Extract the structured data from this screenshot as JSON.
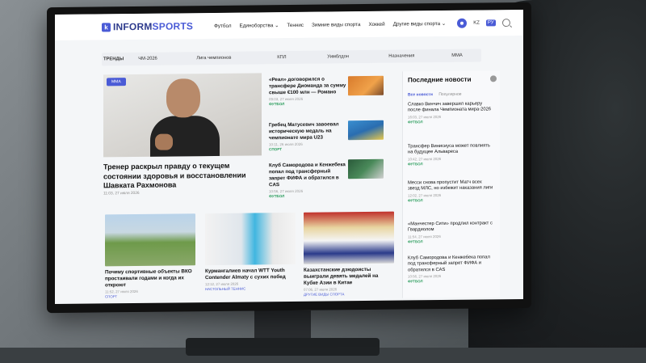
{
  "logo": {
    "letter": "k",
    "name_a": "INFORM",
    "name_b": "SPORTS"
  },
  "nav": [
    "Футбол",
    "Единоборства ⌄",
    "Теннис",
    "Зимние виды спорта",
    "Хоккей",
    "Другие виды спорта ⌄"
  ],
  "langs": {
    "kz": "KZ",
    "ru": "РУ"
  },
  "trends": {
    "label": "ТРЕНДЫ",
    "items": [
      "ЧМ-2026",
      "Лига чемпионов",
      "КПЛ",
      "Уимблдон",
      "Назначения",
      "ММА"
    ]
  },
  "feature": {
    "badge": "ММА",
    "title": "Тренер раскрыл правду о текущем состоянии здоровья и восстановлении Шавката Рахмонова",
    "time": "11:03, 27 июля 2026"
  },
  "middle": [
    {
      "title": "«Реал» договорился о трансфере Диоманда за сумму свыше €100 млн — Романо",
      "time": "09:03, 27 июля 2026",
      "cat": "ФУТБОЛ"
    },
    {
      "title": "Гребец Матусевич завоевал историческую медаль на чемпионате мира U23",
      "time": "10:11, 26 июля 2026",
      "cat": "СПОРТ"
    },
    {
      "title": "Клуб Самородова и Кенжебека попал под трансферный запрет ФИФА и обратился в CAS",
      "time": "10:56, 27 июля 2026",
      "cat": "ФУТБОЛ"
    }
  ],
  "sidebar": {
    "title": "Последние новости",
    "tab_all": "Все новости",
    "tab_popular": "Популярное",
    "items": [
      {
        "title": "Славко Винчич завершил карьеру после финала Чемпионата мира-2026",
        "time": "16:03, 27 июля 2026",
        "cat": "ФУТБОЛ"
      },
      {
        "title": "Трансфер Винисиуса может повлиять на будущее Альвареса",
        "time": "10:42, 27 июля 2026",
        "cat": "ФУТБОЛ"
      },
      {
        "title": "Месси снова пропустит Матч всех звезд МЛС, но избежит наказания лиги",
        "time": "12:02, 27 июля 2026",
        "cat": "ФУТБОЛ"
      },
      {
        "title": "«Манчестер Сити» продлил контракт с Гвардиолом",
        "time": "11:54, 27 июля 2026",
        "cat": "ФУТБОЛ"
      },
      {
        "title": "Клуб Самородова и Кенжебека попал под трансферный запрет ФИФА и обратился в CAS",
        "time": "10:56, 27 июля 2026",
        "cat": "ФУТБОЛ"
      }
    ]
  },
  "cards": [
    {
      "title": "Почему спортивные объекты ВКО простаивали годами и когда их откроют",
      "time": "11:52, 27 июля 2026",
      "cat": "СПОРТ"
    },
    {
      "title": "Курмангалиев начал WTT Youth Contender Almaty с сухих побед",
      "time": "12:12, 27 июля 2026",
      "cat": "НАСТОЛЬНЫЙ ТЕННИС"
    },
    {
      "title": "Казахстанские дзюдоисты выиграли девять медалей на Кубке Азии в Китае",
      "time": "07:06, 27 июля 2026",
      "cat": "ДРУГИЕ ВИДЫ СПОРТА"
    }
  ],
  "colors": {
    "accent": "#4a5bd6",
    "green": "#2a9d5c"
  },
  "icons": [
    "theme-toggle-icon",
    "search-icon",
    "arrow-right-icon"
  ]
}
